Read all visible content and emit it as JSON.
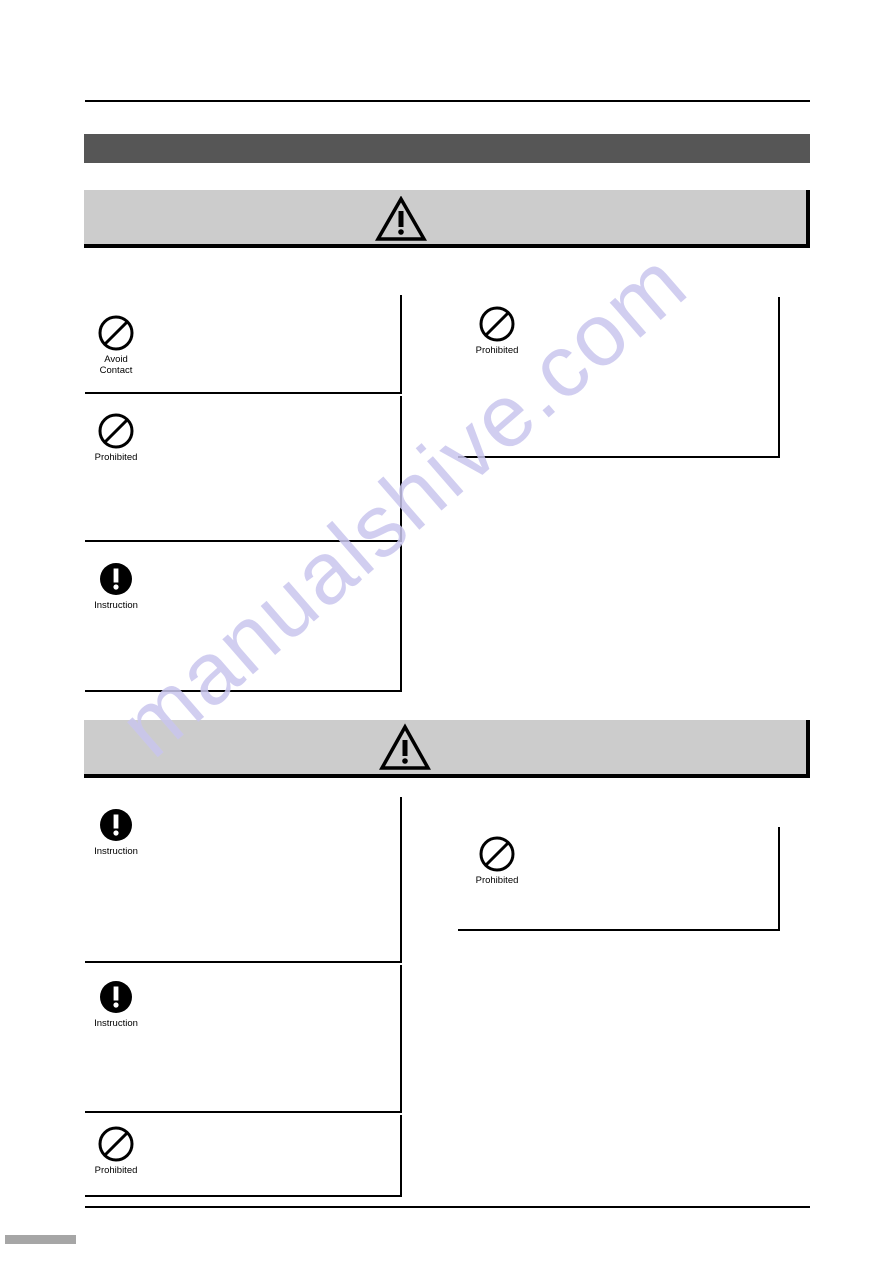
{
  "document": {
    "header_band_label": "",
    "watermark": "manualshive.com"
  },
  "sections": [
    {
      "id": "warning",
      "banner": {
        "icon": "warning-triangle-icon",
        "label": ""
      },
      "boxes_left": [
        {
          "icon": "avoid-contact-icon",
          "caption": "Avoid\nContact",
          "text": ""
        },
        {
          "icon": "prohibited-icon",
          "caption": "Prohibited",
          "text": ""
        },
        {
          "icon": "instruction-icon",
          "caption": "Instruction",
          "text": ""
        }
      ],
      "boxes_right": [
        {
          "icon": "prohibited-icon",
          "caption": "Prohibited",
          "text": ""
        }
      ]
    },
    {
      "id": "caution",
      "banner": {
        "icon": "warning-triangle-icon",
        "label": ""
      },
      "boxes_left": [
        {
          "icon": "instruction-icon",
          "caption": "Instruction",
          "text": ""
        },
        {
          "icon": "instruction-icon",
          "caption": "Instruction",
          "text": ""
        },
        {
          "icon": "prohibited-icon",
          "caption": "Prohibited",
          "text": ""
        }
      ],
      "boxes_right": [
        {
          "icon": "prohibited-icon",
          "caption": "Prohibited",
          "text": ""
        }
      ]
    }
  ],
  "footer": {
    "page_marker": ""
  }
}
